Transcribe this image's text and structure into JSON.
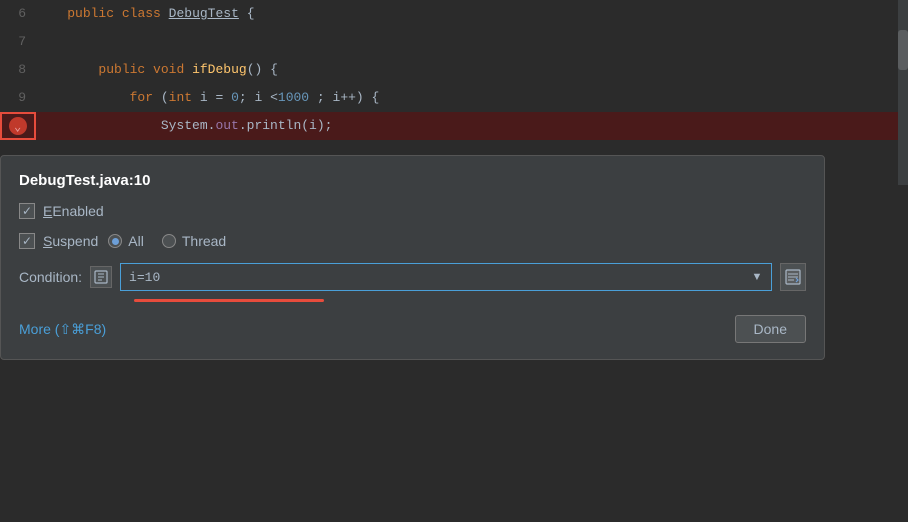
{
  "editor": {
    "lines": [
      {
        "number": "6",
        "content": "public class DebugTest {",
        "highlighted": false
      },
      {
        "number": "7",
        "content": "",
        "highlighted": false
      },
      {
        "number": "8",
        "content": "    public void ifDebug() {",
        "highlighted": false
      },
      {
        "number": "9",
        "content": "        for (int i = 0; i <1000 ; i++) {",
        "highlighted": false
      },
      {
        "number": "10",
        "content": "            System.out.println(i);",
        "highlighted": true
      }
    ]
  },
  "dialog": {
    "title": "DebugTest.java:10",
    "enabled_label": "Enabled",
    "suspend_label": "Suspend",
    "all_label": "All",
    "thread_label": "Thread",
    "condition_label": "Condition:",
    "condition_value": "i=10",
    "condition_placeholder": "",
    "more_label": "More (⇧⌘F8)",
    "done_label": "Done"
  }
}
